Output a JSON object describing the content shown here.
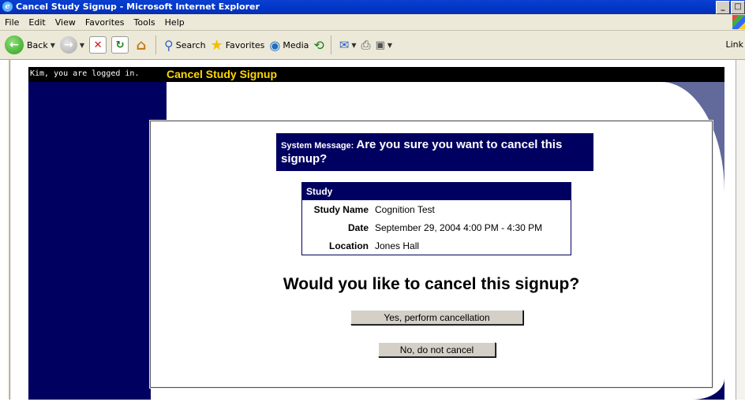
{
  "window": {
    "title": "Cancel Study Signup - Microsoft Internet Explorer",
    "minimize": "_",
    "maximize": "□"
  },
  "menu": {
    "items": [
      "File",
      "Edit",
      "View",
      "Favorites",
      "Tools",
      "Help"
    ]
  },
  "toolbar": {
    "back": "Back",
    "search": "Search",
    "favorites": "Favorites",
    "media": "Media",
    "links": "Link"
  },
  "header": {
    "login_status": "Kim, you are logged in.",
    "page_title": "Cancel Study Signup"
  },
  "system_message": {
    "label": "System Message:",
    "text": "Are you sure you want to cancel this signup?"
  },
  "study": {
    "heading": "Study",
    "rows": [
      {
        "key": "Study Name",
        "value": "Cognition Test"
      },
      {
        "key": "Date",
        "value": "September 29, 2004 4:00 PM - 4:30 PM"
      },
      {
        "key": "Location",
        "value": "Jones Hall"
      }
    ]
  },
  "question": "Would you like to cancel this signup?",
  "buttons": {
    "yes": "Yes, perform cancellation",
    "no": "No, do not cancel"
  }
}
